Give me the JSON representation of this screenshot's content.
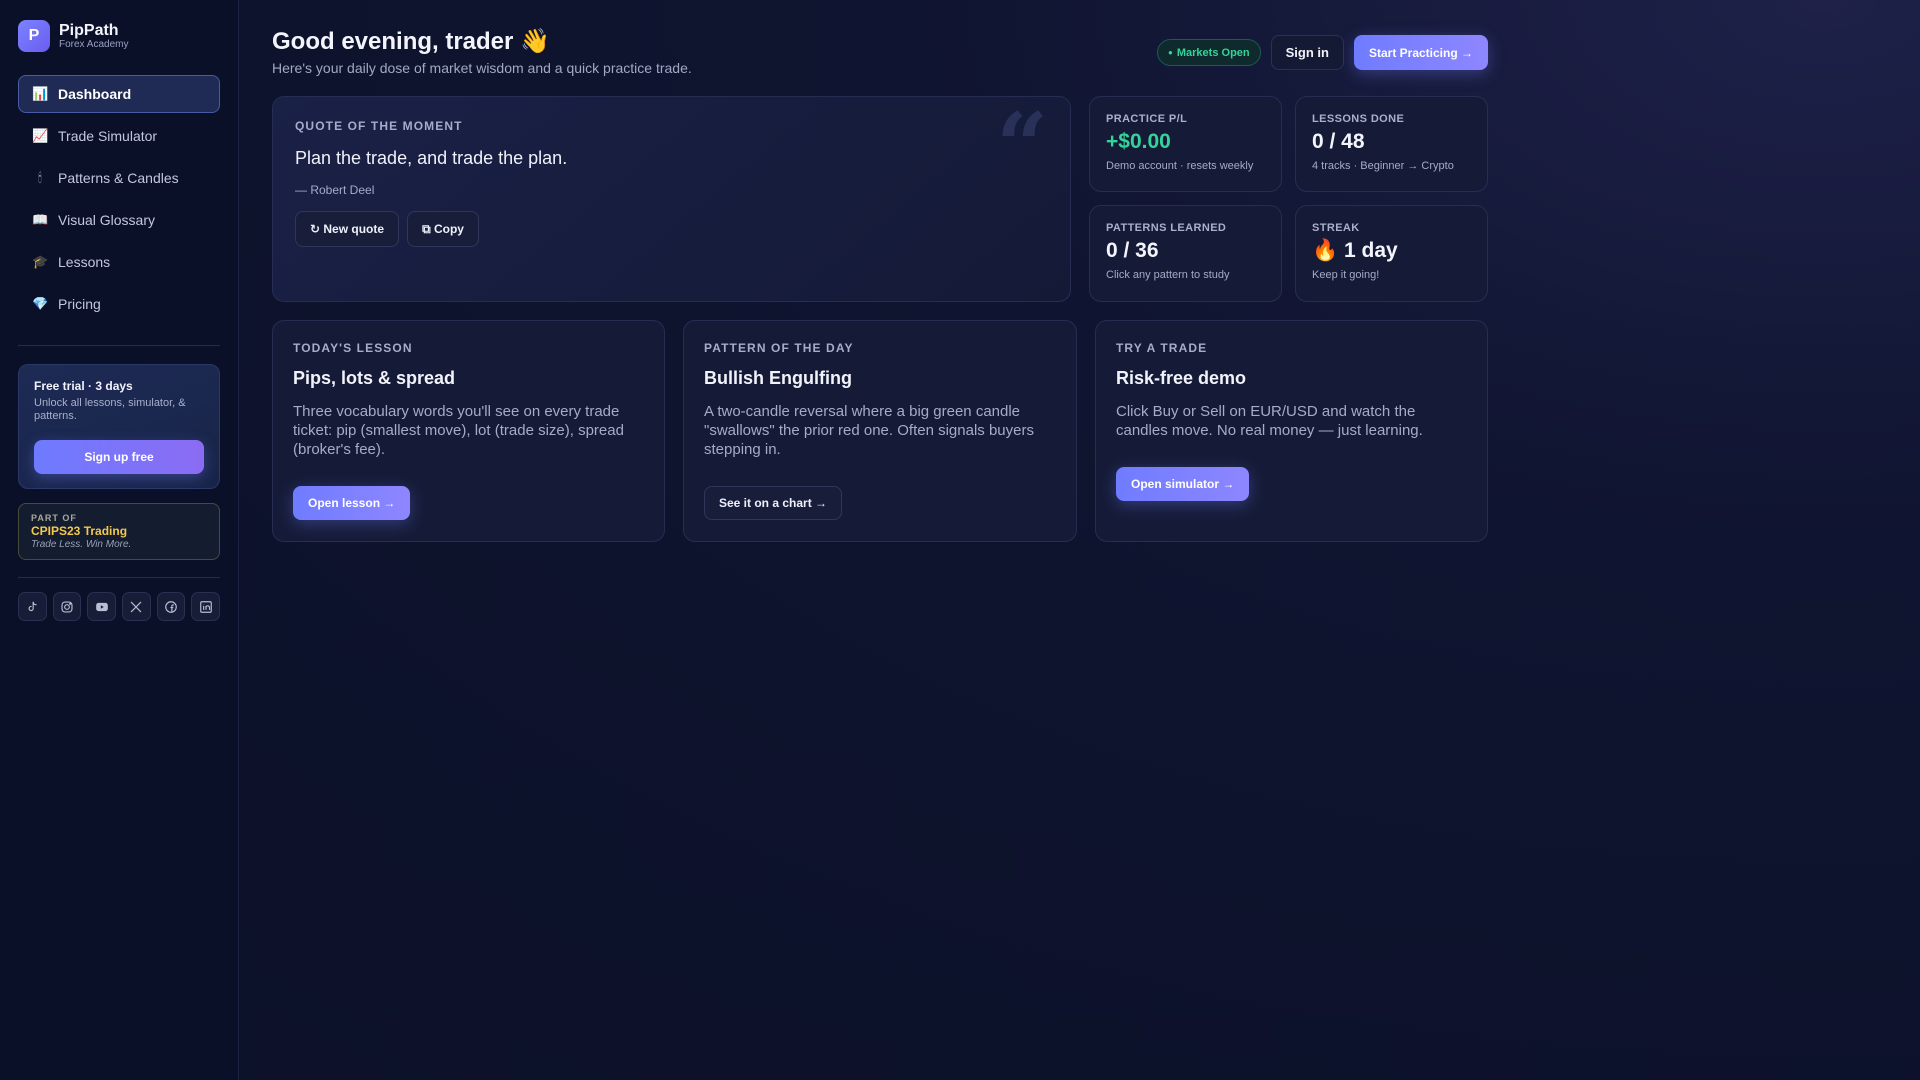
{
  "brand": {
    "logo_letter": "P",
    "name": "PipPath",
    "subtitle": "Forex Academy"
  },
  "sidebar": {
    "items": [
      {
        "label": "Dashboard",
        "icon": "📊",
        "icon_name": "bar-chart-icon",
        "active": true
      },
      {
        "label": "Trade Simulator",
        "icon": "📈",
        "icon_name": "trend-chart-icon"
      },
      {
        "label": "Patterns & Candles",
        "icon": "🕯",
        "icon_name": "candle-icon"
      },
      {
        "label": "Visual Glossary",
        "icon": "📖",
        "icon_name": "book-icon"
      },
      {
        "label": "Lessons",
        "icon": "🎓",
        "icon_name": "graduation-cap-icon"
      },
      {
        "label": "Pricing",
        "icon": "💎",
        "icon_name": "diamond-icon"
      }
    ],
    "trial": {
      "title": "Free trial · 3 days",
      "description": "Unlock all lessons, simulator, & patterns.",
      "button": "Sign up free"
    },
    "part_of": {
      "label": "PART OF",
      "name": "CPIPS23 Trading",
      "tagline": "Trade Less. Win More."
    },
    "socials": [
      "tiktok-icon",
      "instagram-icon",
      "youtube-icon",
      "x-icon",
      "facebook-icon",
      "linkedin-icon"
    ]
  },
  "header": {
    "greeting": "Good evening, trader 👋",
    "subtitle": "Here's your daily dose of market wisdom and a quick practice trade.",
    "market_status": "Markets Open",
    "signin": "Sign in",
    "cta": "Start Practicing →"
  },
  "quote": {
    "label": "QUOTE OF THE MOMENT",
    "text": "Plan the trade, and trade the plan.",
    "author": "— Robert Deel",
    "new_quote": "↻ New quote",
    "copy": "⧉ Copy",
    "mark": "“"
  },
  "stats": [
    {
      "label": "PRACTICE P/L",
      "value": "+$0.00",
      "sub": "Demo account · resets weekly"
    },
    {
      "label": "LESSONS DONE",
      "value": "0 / 48",
      "sub": "4 tracks · Beginner → Crypto"
    },
    {
      "label": "PATTERNS LEARNED",
      "value": "0 / 36",
      "sub": "Click any pattern to study"
    },
    {
      "label": "STREAK",
      "value": "🔥 1 day",
      "sub": "Keep it going!"
    }
  ],
  "features": [
    {
      "label": "TODAY'S LESSON",
      "title": "Pips, lots & spread",
      "description": "Three vocabulary words you'll see on every trade ticket: pip (smallest move), lot (trade size), spread (broker's fee).",
      "button": "Open lesson →"
    },
    {
      "label": "PATTERN OF THE DAY",
      "title": "Bullish Engulfing",
      "description": "A two-candle reversal where a big green candle \"swallows\" the prior red one. Often signals buyers stepping in.",
      "button": "See it on a chart →"
    },
    {
      "label": "TRY A TRADE",
      "title": "Risk-free demo",
      "description": "Click Buy or Sell on EUR/USD and watch the candles move. No real money — just learning.",
      "button": "Open simulator →"
    }
  ],
  "colors": {
    "accent": "#6f7cff",
    "positive": "#34d399",
    "gold": "#f2c94c",
    "background": "#0c1128"
  }
}
